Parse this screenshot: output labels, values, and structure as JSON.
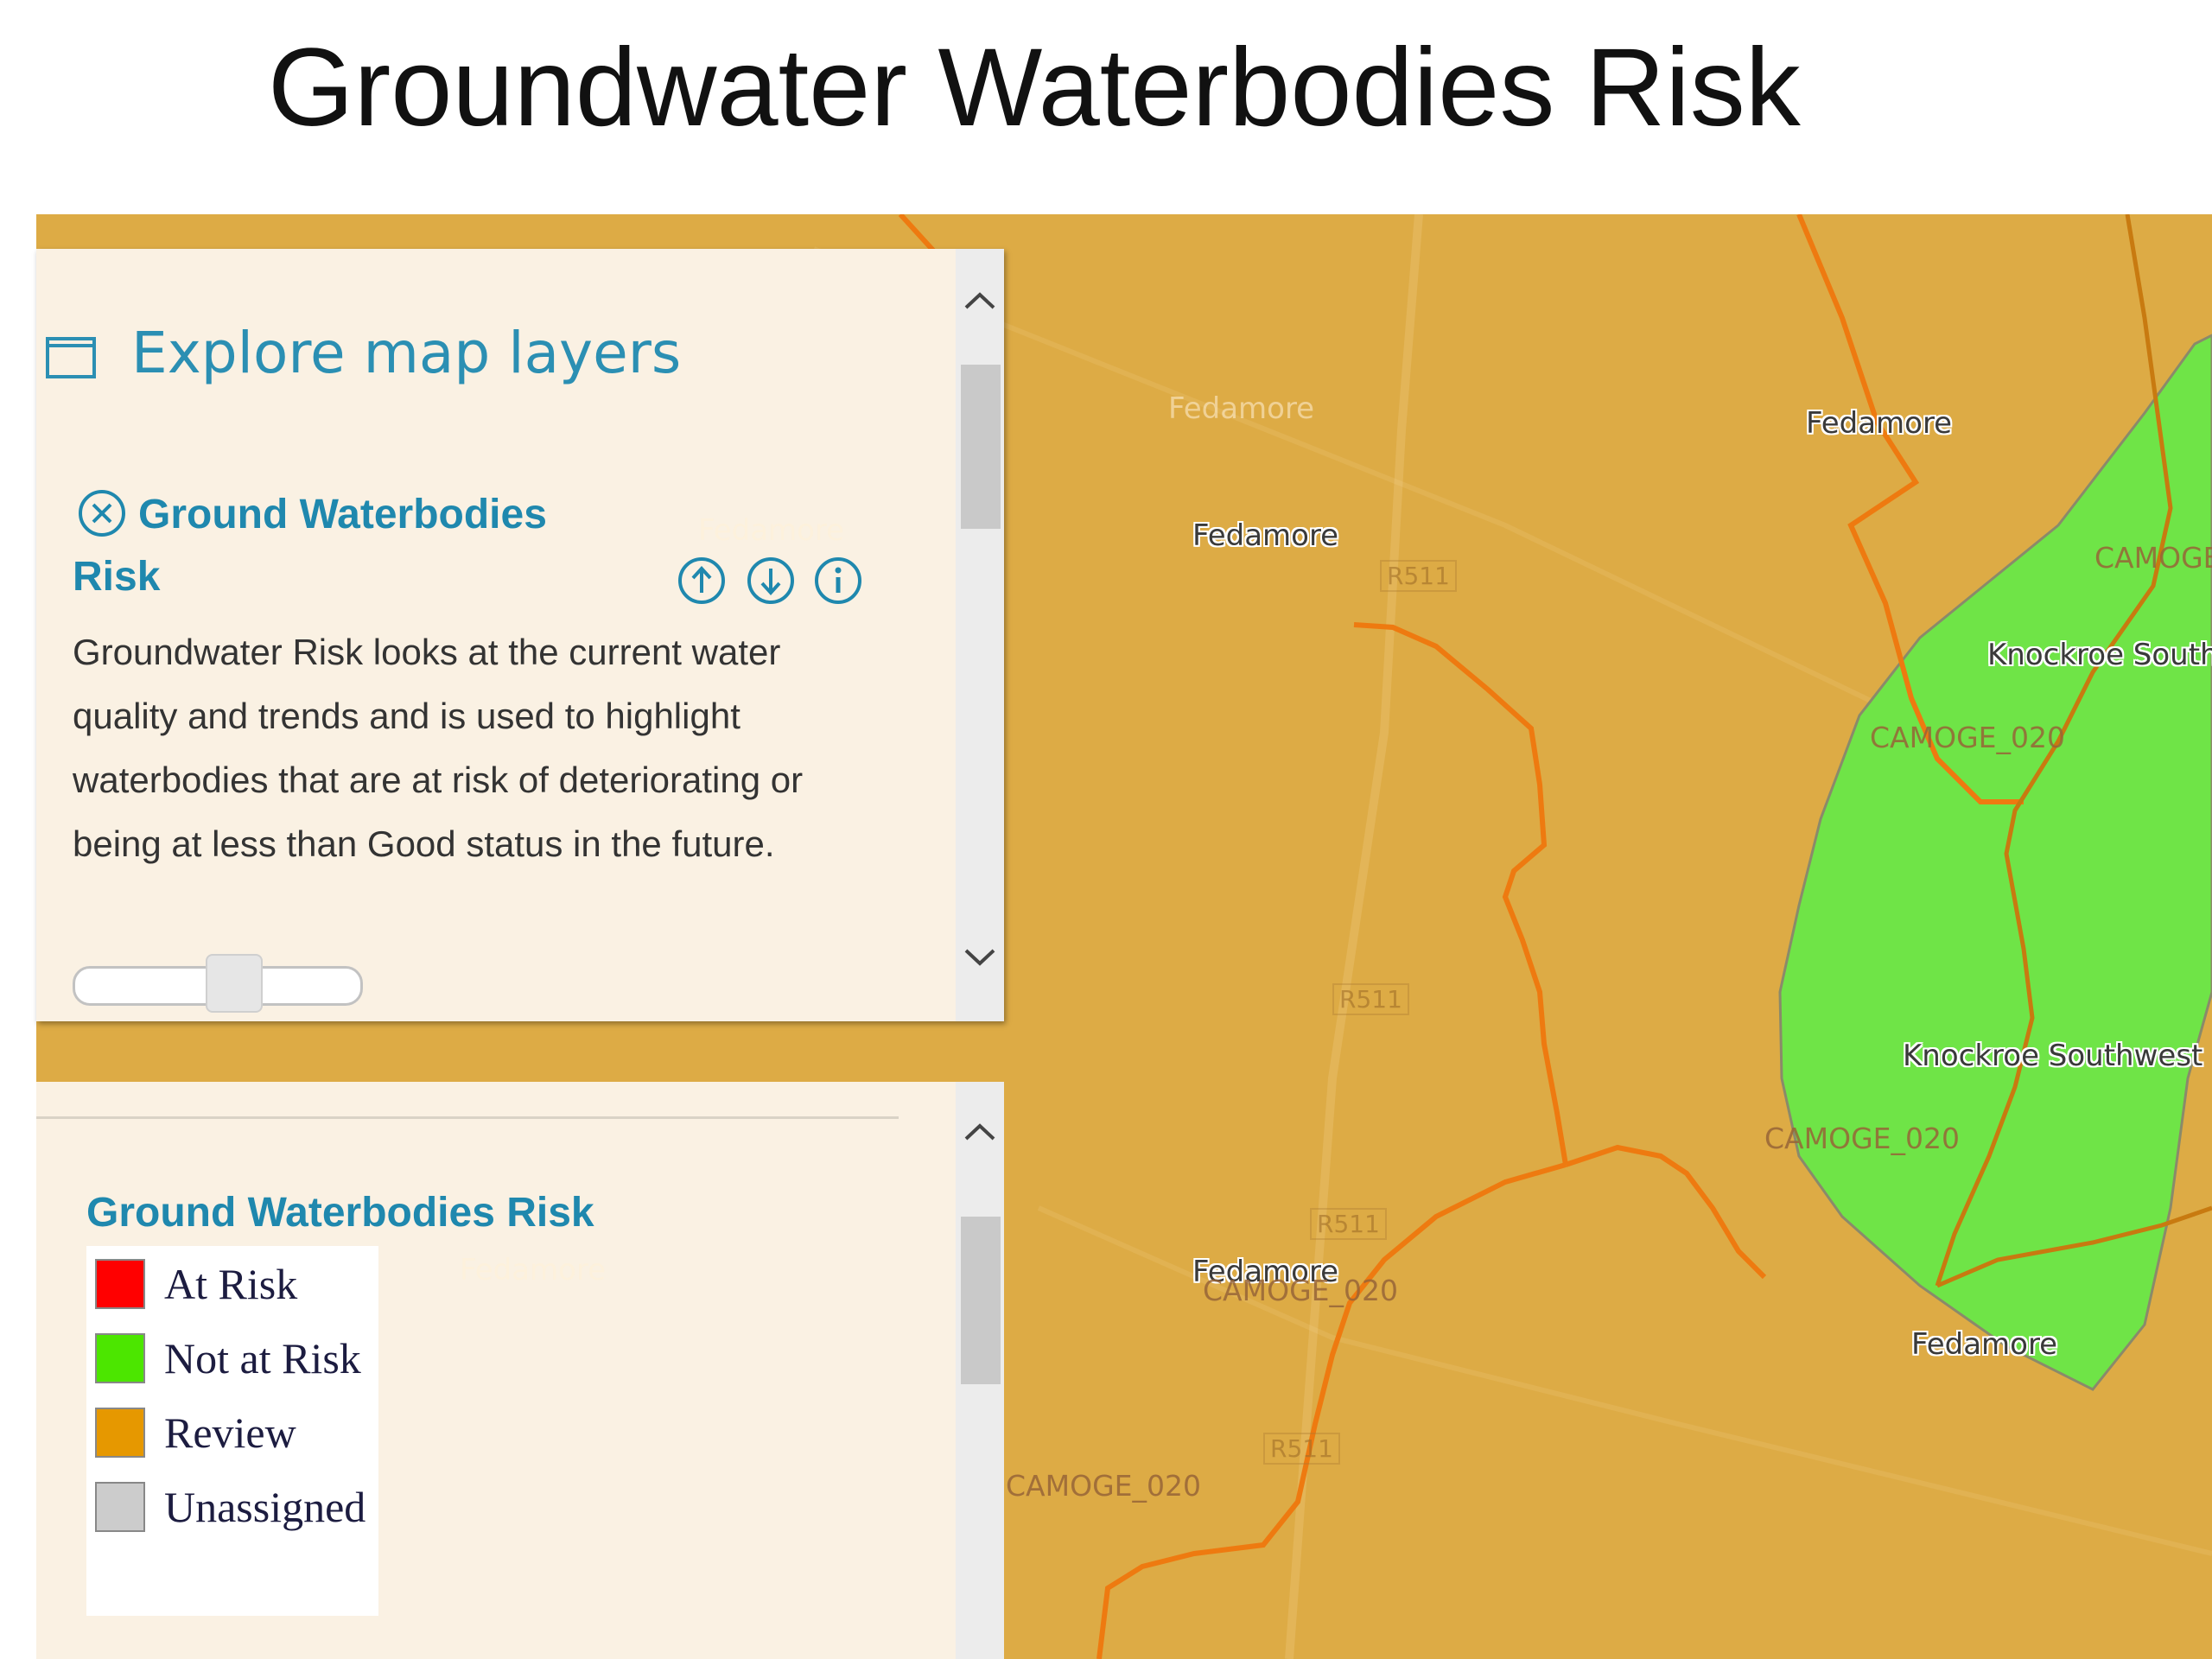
{
  "slide": {
    "title": "Groundwater Waterbodies Risk"
  },
  "panel": {
    "header": "Explore map layers",
    "layer": {
      "title_line1": "Ground Waterbodies",
      "title_line2": "Risk",
      "description": "Groundwater Risk looks at the current water quality and trends and is used to highlight waterbodies that are at risk of deteriorating or being at less than Good status in the future."
    }
  },
  "legend": {
    "title": "Ground Waterbodies Risk",
    "items": [
      {
        "label": "At Risk",
        "color": "#FF0000"
      },
      {
        "label": "Not at Risk",
        "color": "#4CE600"
      },
      {
        "label": "Review",
        "color": "#E69800"
      },
      {
        "label": "Unassigned",
        "color": "#CCCCCC"
      }
    ]
  },
  "map": {
    "colors": {
      "review_area": "#DDAB45",
      "not_at_risk_area": "#6FE447",
      "river": "#EE7A10"
    },
    "labels": {
      "fedamore_1": "Fedamore",
      "fedamore_2": "Fedamore",
      "fedamore_3": "Fedamore",
      "fedamore_4": "Fedamore",
      "fedamore_faint_1": "Fedamore",
      "fedamore_faint_2": "Fedamore",
      "fedamore_faint_3": "Fedamore",
      "knockroe_south": "Knockroe South",
      "knockroe_southwest": "Knockroe Southwest",
      "camoge_1": "CAMOGE_020",
      "camoge_2": "CAMOGE_020",
      "camoge_3": "CAMOGE_020",
      "camoge_4": "CAMOGE_020",
      "camoge_5": "CAMOGE",
      "road_1": "R511",
      "road_2": "R511",
      "road_3": "R511",
      "road_4": "R511"
    }
  }
}
